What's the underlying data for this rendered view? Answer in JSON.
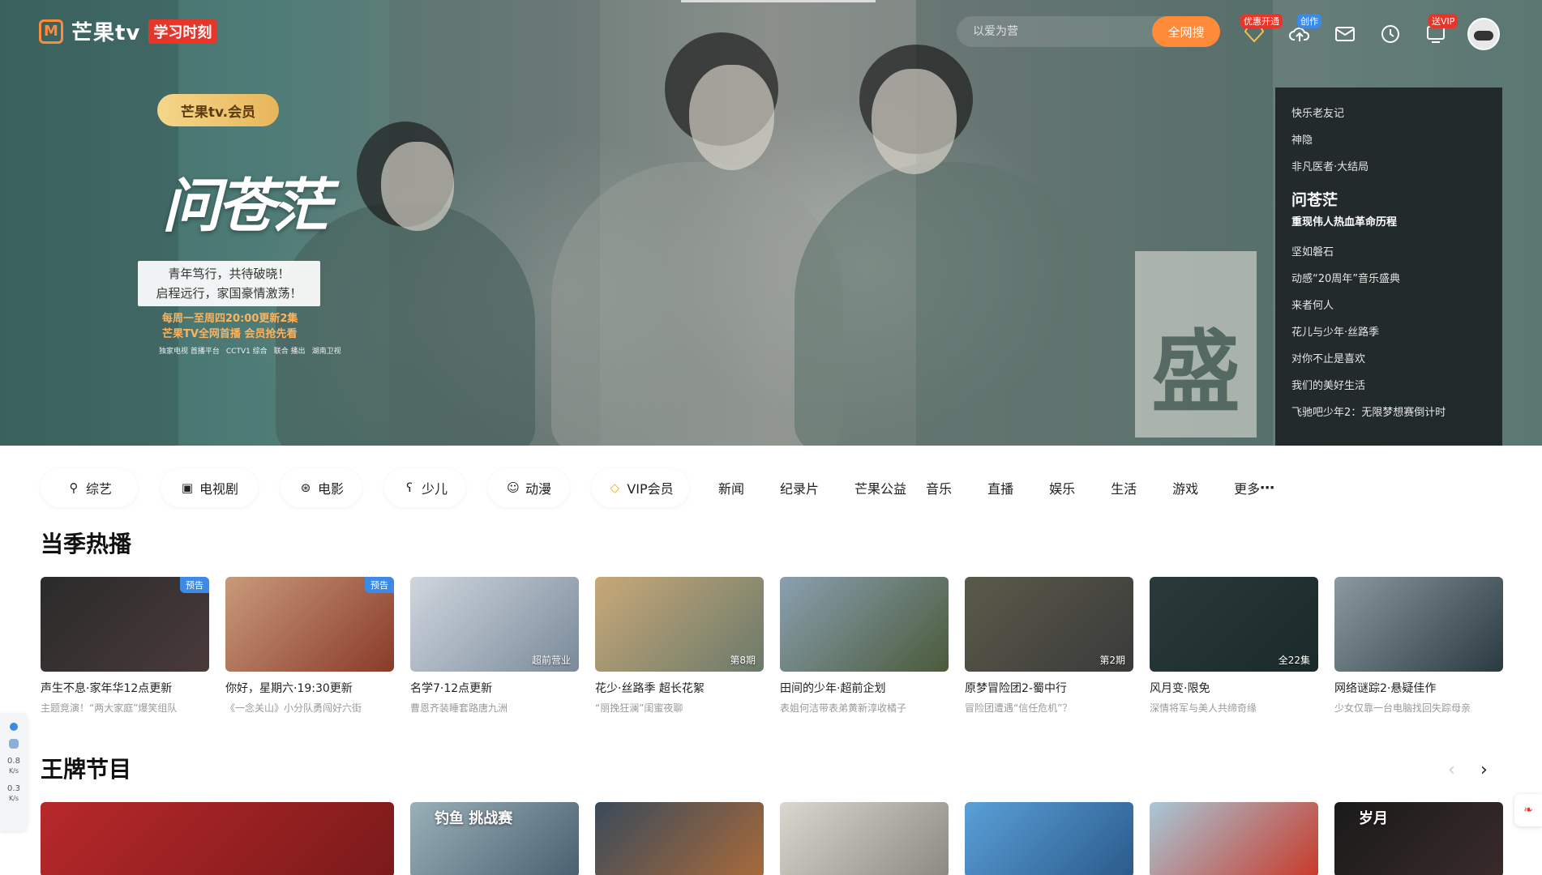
{
  "header": {
    "logo_text": "芒果tv",
    "logo_badge": "学习时刻",
    "search_placeholder": "以爱为营",
    "search_button": "全网搜",
    "tags": {
      "promo": "优惠开通",
      "create": "创作",
      "vip": "送VIP"
    }
  },
  "hero": {
    "member_badge": "芒果tv.会员",
    "show_title": "问苍茫",
    "slogan_line1": "青年笃行，共待破晓！",
    "slogan_line2": "启程远行，家国豪情激荡！",
    "schedule_line1": "每周一至周四20:00更新2集",
    "schedule_line2": "芒果TV全网首播  会员抢先看",
    "broadcasters": [
      "独家电视 首播平台",
      "CCTV1 综合",
      "联合 播出",
      "湖南卫视"
    ],
    "sign_char": "盛",
    "playlist": [
      {
        "label": "快乐老友记"
      },
      {
        "label": "神隐"
      },
      {
        "label": "非凡医者·大结局"
      },
      {
        "label": "问苍茫",
        "sub": "重现伟人热血革命历程",
        "active": true
      },
      {
        "label": "坚如磐石"
      },
      {
        "label": "动感“20周年”音乐盛典"
      },
      {
        "label": "来者何人"
      },
      {
        "label": "花儿与少年·丝路季"
      },
      {
        "label": "对你不止是喜欢"
      },
      {
        "label": "我们的美好生活"
      },
      {
        "label": "飞驰吧少年2：无限梦想赛倒计时"
      }
    ]
  },
  "categories": {
    "pills": [
      {
        "label": "综艺",
        "icon": "search-icon"
      },
      {
        "label": "电视剧",
        "icon": "tv-icon"
      },
      {
        "label": "电影",
        "icon": "film-reel-icon"
      },
      {
        "label": "少儿",
        "icon": "bear-icon"
      },
      {
        "label": "动漫",
        "icon": "anime-icon"
      },
      {
        "label": "VIP会员",
        "icon": "diamond-icon"
      }
    ],
    "links": [
      "新闻",
      "纪录片",
      "芒果公益",
      "音乐",
      "直播",
      "娱乐",
      "生活",
      "游戏",
      "更多"
    ]
  },
  "sections": {
    "hot": {
      "title": "当季热播",
      "cards": [
        {
          "title": "声生不息·家年华12点更新",
          "sub": "主题竞演！“两大家庭”爆笑组队",
          "badge": "预告",
          "ep": "",
          "c1": "#2a2a2a",
          "c2": "#4a3a3a"
        },
        {
          "title": "你好，星期六·19:30更新",
          "sub": "《一念关山》小分队勇闯好六街",
          "badge": "预告",
          "ep": "",
          "c1": "#c89a7a",
          "c2": "#8a3a2a"
        },
        {
          "title": "名学7·12点更新",
          "sub": "曹恩齐装睡套路唐九洲",
          "badge": "",
          "ep": "超前营业",
          "c1": "#cfd6de",
          "c2": "#7a8a9a"
        },
        {
          "title": "花少·丝路季 超长花絮",
          "sub": "“丽挽狂澜”闺蜜夜聊",
          "badge": "",
          "ep": "第8期",
          "c1": "#c8a878",
          "c2": "#6a7a6a"
        },
        {
          "title": "田间的少年·超前企划",
          "sub": "表姐何洁带表弟黄新淳收橘子",
          "badge": "",
          "ep": "",
          "c1": "#8aa0b0",
          "c2": "#4a5a3a"
        },
        {
          "title": "原梦冒险团2-蜀中行",
          "sub": "冒险团遭遇“信任危机”？",
          "badge": "",
          "ep": "第2期",
          "c1": "#5a5a4a",
          "c2": "#3a3a3a"
        },
        {
          "title": "风月变·限免",
          "sub": "深情将军与美人共缔奇缘",
          "badge": "",
          "ep": "全22集",
          "c1": "#2a3a3a",
          "c2": "#1a2a2a"
        },
        {
          "title": "网络谜踪2·悬疑佳作",
          "sub": "少女仅靠一台电脑找回失踪母亲",
          "badge": "",
          "ep": "",
          "c1": "#8a9aa0",
          "c2": "#2a3a40"
        }
      ]
    },
    "ace": {
      "title": "王牌节目",
      "cards": [
        {
          "c1": "#b8282a",
          "c2": "#7a1a1a",
          "wide": true,
          "overlay": ""
        },
        {
          "c1": "#9ab0b8",
          "c2": "#4a6070",
          "wide": false,
          "overlay": "钓鱼 挑战赛"
        },
        {
          "c1": "#3a4a5a",
          "c2": "#a86a3a",
          "wide": false,
          "overlay": ""
        },
        {
          "c1": "#d8d8d0",
          "c2": "#8a8a80",
          "wide": false,
          "overlay": ""
        },
        {
          "c1": "#5aa0d8",
          "c2": "#2a5a8a",
          "wide": false,
          "overlay": ""
        },
        {
          "c1": "#a8c8d8",
          "c2": "#c83a2a",
          "wide": false,
          "overlay": ""
        },
        {
          "c1": "#1a1a1a",
          "c2": "#3a2a2a",
          "wide": false,
          "overlay": "岁月"
        }
      ]
    }
  },
  "widgets": {
    "speed_up": "0.8",
    "speed_down": "0.3",
    "unit": "K/s"
  }
}
